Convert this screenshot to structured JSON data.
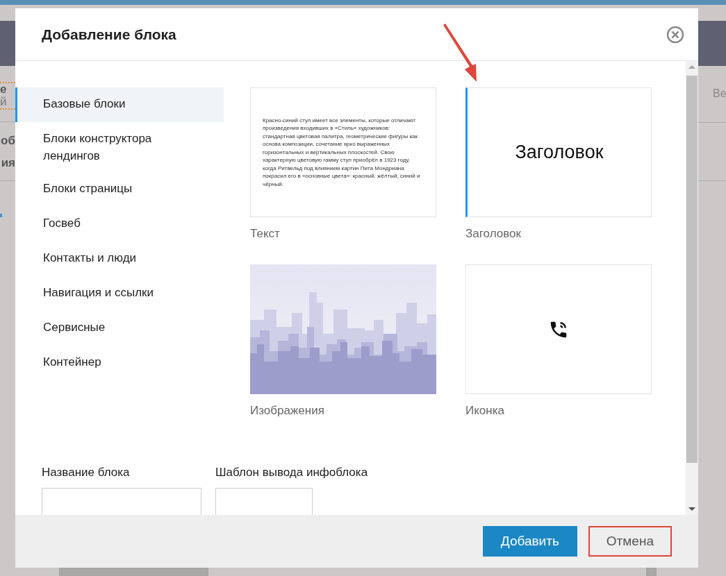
{
  "background": {
    "left_texts": [
      "е",
      "й",
      "об",
      "ия"
    ],
    "right_text": "Ве"
  },
  "dialog": {
    "title": "Добавление блока"
  },
  "sidebar": {
    "items": [
      {
        "label": "Базовые блоки",
        "selected": true
      },
      {
        "label": "Блоки конструктора лендингов",
        "selected": false
      },
      {
        "label": "Блоки страницы",
        "selected": false
      },
      {
        "label": "Госвеб",
        "selected": false
      },
      {
        "label": "Контакты и люди",
        "selected": false
      },
      {
        "label": "Навигация и ссылки",
        "selected": false
      },
      {
        "label": "Сервисные",
        "selected": false
      },
      {
        "label": "Контейнер",
        "selected": false
      }
    ]
  },
  "blocks": [
    {
      "kind": "text",
      "caption": "Текст",
      "preview": "Красно-синий стул имеет все элементы, которые отличают произведения входивших в «Стиль» художников: стандартная цветовая палитра, геометрические фигуры как основа композиции, сочетание ярко выраженных горизонтальных и вертикальных плоскостей. Свою характерную цветовую гамму стул приобрёл в 1923 году, когда Ритвельд под влиянием картин Пита Мондриана покрасил его в «основные цвета»: красный, жёлтый, синий и чёрный.",
      "selected": false
    },
    {
      "kind": "heading",
      "caption": "Заголовок",
      "preview": "Заголовок",
      "selected": true
    },
    {
      "kind": "picture",
      "caption": "Изображения",
      "selected": false
    },
    {
      "kind": "icon",
      "caption": "Иконка",
      "selected": false
    }
  ],
  "fields": [
    {
      "label": "Название блока"
    },
    {
      "label": "Шаблон вывода инфоблока"
    }
  ],
  "buttons": [
    {
      "label": "Добавить",
      "kind": "primary"
    },
    {
      "label": "Отмена",
      "kind": "cancel"
    }
  ]
}
